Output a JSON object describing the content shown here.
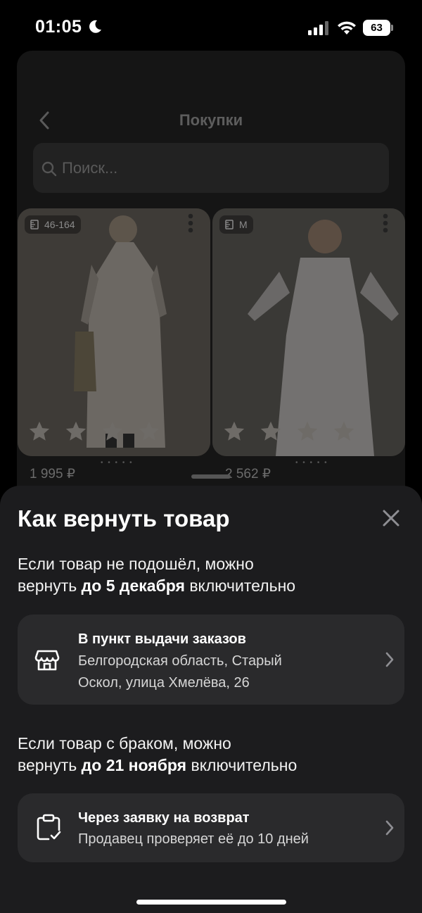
{
  "status_bar": {
    "time": "01:05",
    "battery": "63",
    "icons": [
      "moon-icon",
      "cellular-signal-icon",
      "wifi-icon",
      "battery-icon"
    ]
  },
  "background_screen": {
    "title": "Покупки",
    "search_placeholder": "Поиск...",
    "products": [
      {
        "size": "46-164",
        "price": "1 995 ₽",
        "rating_stars": 5
      },
      {
        "size": "M",
        "price": "2 562 ₽",
        "rating_stars": 5
      }
    ],
    "pager_dots": "• • • • •"
  },
  "sheet": {
    "title": "Как вернуть товар",
    "normal_return": {
      "line1": "Если товар не подошёл, можно",
      "line2_prefix": "вернуть ",
      "deadline": "до 5 декабря",
      "line2_suffix": " включительно"
    },
    "pickup_option": {
      "title": "В пункт выдачи заказов",
      "address_line1": "Белгородская область, Старый",
      "address_line2": "Оскол, улица Хмелёва, 26"
    },
    "defect_return": {
      "line1": "Если товар с браком, можно",
      "line2_prefix": "вернуть ",
      "deadline": "до 21 ноября",
      "line2_suffix": " включительно"
    },
    "request_option": {
      "title": "Через заявку на возврат",
      "subtitle": "Продавец проверяет её до 10 дней"
    }
  },
  "colors": {
    "sheet_bg": "#1c1c1e",
    "option_bg": "#2a2a2c",
    "text_primary": "#ffffff"
  }
}
